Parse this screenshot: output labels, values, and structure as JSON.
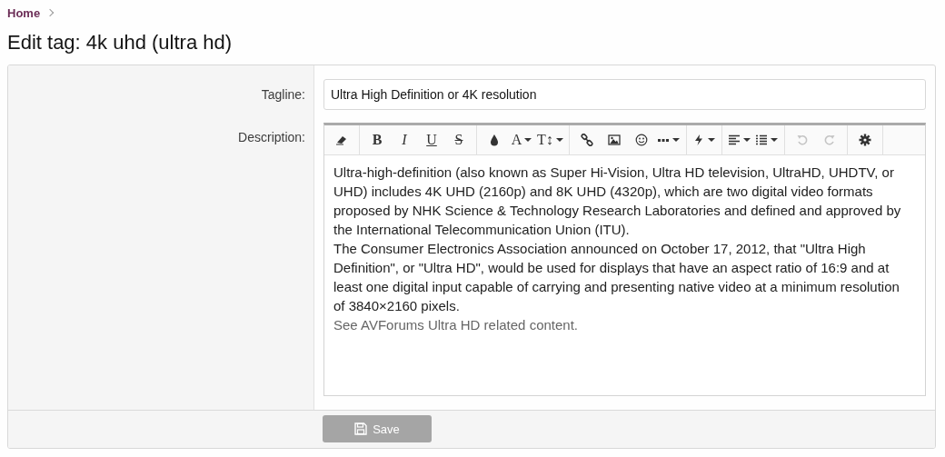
{
  "breadcrumb": [
    {
      "label": "Home"
    }
  ],
  "title": "Edit tag: 4k uhd (ultra hd)",
  "form": {
    "tagline": {
      "label": "Tagline:",
      "value": "Ultra High Definition or 4K resolution"
    },
    "description": {
      "label": "Description:",
      "toolbar": [
        [
          {
            "kind": "eraser",
            "dropdown": false,
            "disabled": false
          }
        ],
        [
          {
            "kind": "letter",
            "label": "B",
            "dropdown": false,
            "disabled": false
          },
          {
            "kind": "letter",
            "label": "I",
            "dropdown": false,
            "disabled": false
          },
          {
            "kind": "letter",
            "label": "U",
            "dropdown": false,
            "disabled": false
          },
          {
            "kind": "letter",
            "label": "S",
            "dropdown": false,
            "disabled": false
          }
        ],
        [
          {
            "kind": "drop",
            "dropdown": false,
            "disabled": false
          },
          {
            "kind": "letter",
            "label": "A",
            "dropdown": true,
            "disabled": false
          },
          {
            "kind": "letter",
            "label": "T↕",
            "dropdown": true,
            "disabled": false
          }
        ],
        [
          {
            "kind": "link",
            "dropdown": false,
            "disabled": false
          },
          {
            "kind": "image",
            "dropdown": false,
            "disabled": false
          },
          {
            "kind": "smiley",
            "dropdown": false,
            "disabled": false
          },
          {
            "kind": "more",
            "dropdown": true,
            "disabled": false
          }
        ],
        [
          {
            "kind": "bolt",
            "dropdown": true,
            "disabled": false
          }
        ],
        [
          {
            "kind": "align",
            "dropdown": true,
            "disabled": false
          },
          {
            "kind": "list",
            "dropdown": true,
            "disabled": false
          }
        ],
        [
          {
            "kind": "undo",
            "dropdown": false,
            "disabled": true
          },
          {
            "kind": "redo",
            "dropdown": false,
            "disabled": true
          }
        ],
        [
          {
            "kind": "gear",
            "dropdown": false,
            "disabled": false
          }
        ]
      ],
      "paragraphs": [
        {
          "kind": "text",
          "text": "Ultra-high-definition (also known as Super Hi-Vision, Ultra HD television, UltraHD, UHDTV, or UHD) includes 4K UHD (2160p) and 8K UHD (4320p), which are two digital video formats proposed by NHK Science & Technology Research Laboratories and defined and approved by the International Telecommunication Union (ITU)."
        },
        {
          "kind": "text",
          "text": "The Consumer Electronics Association announced on October 17, 2012, that \"Ultra High Definition\", or \"Ultra HD\", would be used for displays that have an aspect ratio of 16:9 and at least one digital input capable of carrying and presenting native video at a minimum resolution of 3840×2160 pixels."
        },
        {
          "kind": "muted",
          "text": "See AVForums Ultra HD related content."
        }
      ]
    },
    "save": {
      "label": "Save",
      "disabled": true
    }
  }
}
